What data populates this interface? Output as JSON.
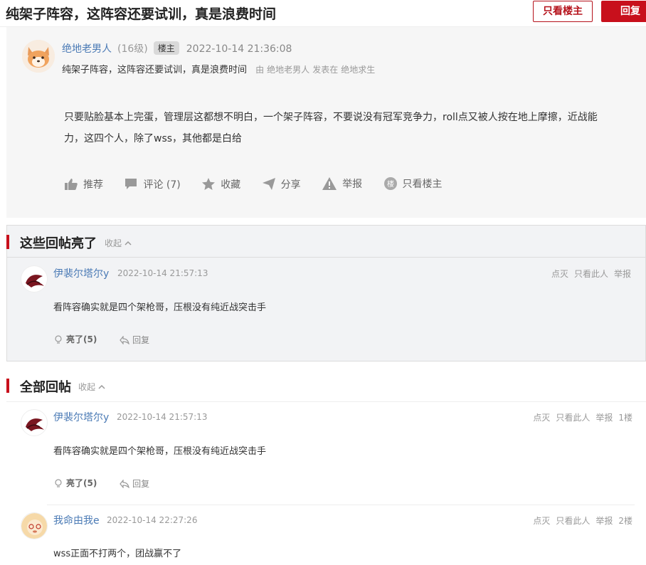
{
  "header": {
    "title": "纯架子阵容，这阵容还要试训，真是浪费时间",
    "only_op_label": "只看楼主",
    "reply_label": "回复"
  },
  "main_post": {
    "username": "绝地老男人",
    "level": "(16级)",
    "op_badge": "楼主",
    "time": "2022-10-14 21:36:08",
    "subtitle": "纯架子阵容，这阵容还要试训，真是浪费时间",
    "by_label": "由",
    "by_user": "绝地老男人",
    "posted_in": "发表在",
    "board": "绝地求生",
    "content": "只要贴脸基本上完蛋，管理层这都想不明白，一个架子阵容，不要说没有冠军竞争力，roll点又被人按在地上摩擦，近战能力，这四个人，除了wss，其他都是白给",
    "actions": {
      "recommend": "推荐",
      "comment": "评论 (7)",
      "favorite": "收藏",
      "share": "分享",
      "report": "举报",
      "only_op": "只看楼主",
      "only_op_icon_text": "楼"
    }
  },
  "hot_section": {
    "title": "这些回帖亮了",
    "collapse": "收起",
    "reply": {
      "username": "伊裴尔塔尔y",
      "time": "2022-10-14 21:57:13",
      "ops": [
        "点灭",
        "只看此人",
        "举报"
      ],
      "text": "看阵容确实就是四个架枪哥，压根没有纯近战突击手",
      "light_label": "亮了",
      "light_count": "(5)",
      "reply_label": "回复"
    }
  },
  "all_section": {
    "title": "全部回帖",
    "collapse": "收起",
    "replies": [
      {
        "username": "伊裴尔塔尔y",
        "time": "2022-10-14 21:57:13",
        "ops": [
          "点灭",
          "只看此人",
          "举报",
          "1楼"
        ],
        "text": "看阵容确实就是四个架枪哥，压根没有纯近战突击手",
        "light_label": "亮了",
        "light_count": "(5)",
        "reply_label": "回复"
      },
      {
        "username": "我命由我e",
        "time": "2022-10-14 22:27:26",
        "ops": [
          "点灭",
          "只看此人",
          "举报",
          "2楼"
        ],
        "text": "wss正面不打两个，团战赢不了"
      }
    ]
  },
  "colors": {
    "accent_red": "#c8101c",
    "link_blue": "#4a7ab5"
  }
}
